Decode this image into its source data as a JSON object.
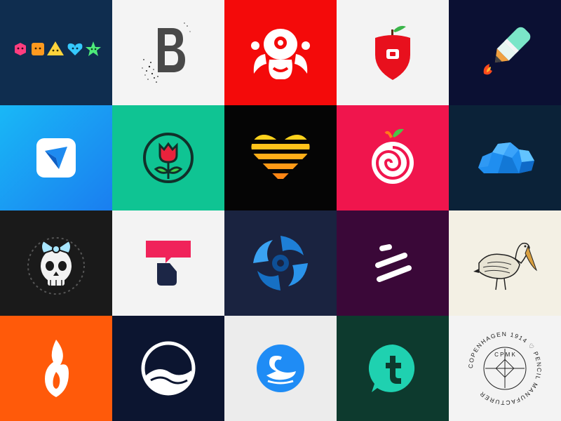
{
  "colors": {
    "t1": "#0f2d4f",
    "t2": "#f4f4f4",
    "t3": "#f40a0a",
    "t4": "#f3f3f3",
    "t5": "#0b1033",
    "t6": "#1aa0ee",
    "t7": "#0fc493",
    "t8": "#050505",
    "t9": "#f0154d",
    "t10": "#0b2238",
    "t11": "#1a1a1a",
    "t12": "#f3f3f3",
    "t13": "#1a2340",
    "t14": "#3a0838",
    "t15": "#f3f0e4",
    "t16": "#ff5a0a",
    "t17": "#0c1530",
    "t18": "#ececec",
    "t19": "#0d3a2e",
    "t20": "#f3f3f3"
  },
  "logos": [
    {
      "icon": "smiley-shapes-icon"
    },
    {
      "icon": "scattered-letter-b-icon"
    },
    {
      "icon": "octopus-creature-icon"
    },
    {
      "icon": "apple-shield-icon"
    },
    {
      "icon": "rocket-pencil-icon"
    },
    {
      "icon": "paper-plane-app-icon"
    },
    {
      "icon": "rose-badge-icon"
    },
    {
      "icon": "striped-heart-icon"
    },
    {
      "icon": "swirl-fruit-icon"
    },
    {
      "icon": "low-poly-cloud-icon"
    },
    {
      "icon": "skull-with-bow-icon"
    },
    {
      "icon": "speech-bubble-t-icon"
    },
    {
      "icon": "shark-vortex-icon"
    },
    {
      "icon": "slanted-lines-mark-icon"
    },
    {
      "icon": "pelican-engraving-icon"
    },
    {
      "icon": "flame-icon"
    },
    {
      "icon": "wave-circle-icon"
    },
    {
      "icon": "swan-circle-icon"
    },
    {
      "icon": "t-chat-bubble-icon"
    },
    {
      "icon": "pencil-stamp-seal-icon"
    }
  ],
  "stamp": {
    "arc_text": "COPENHAGEN 1914 ♡ PENCIL MANUFACTURER",
    "initials": "C P M K"
  }
}
